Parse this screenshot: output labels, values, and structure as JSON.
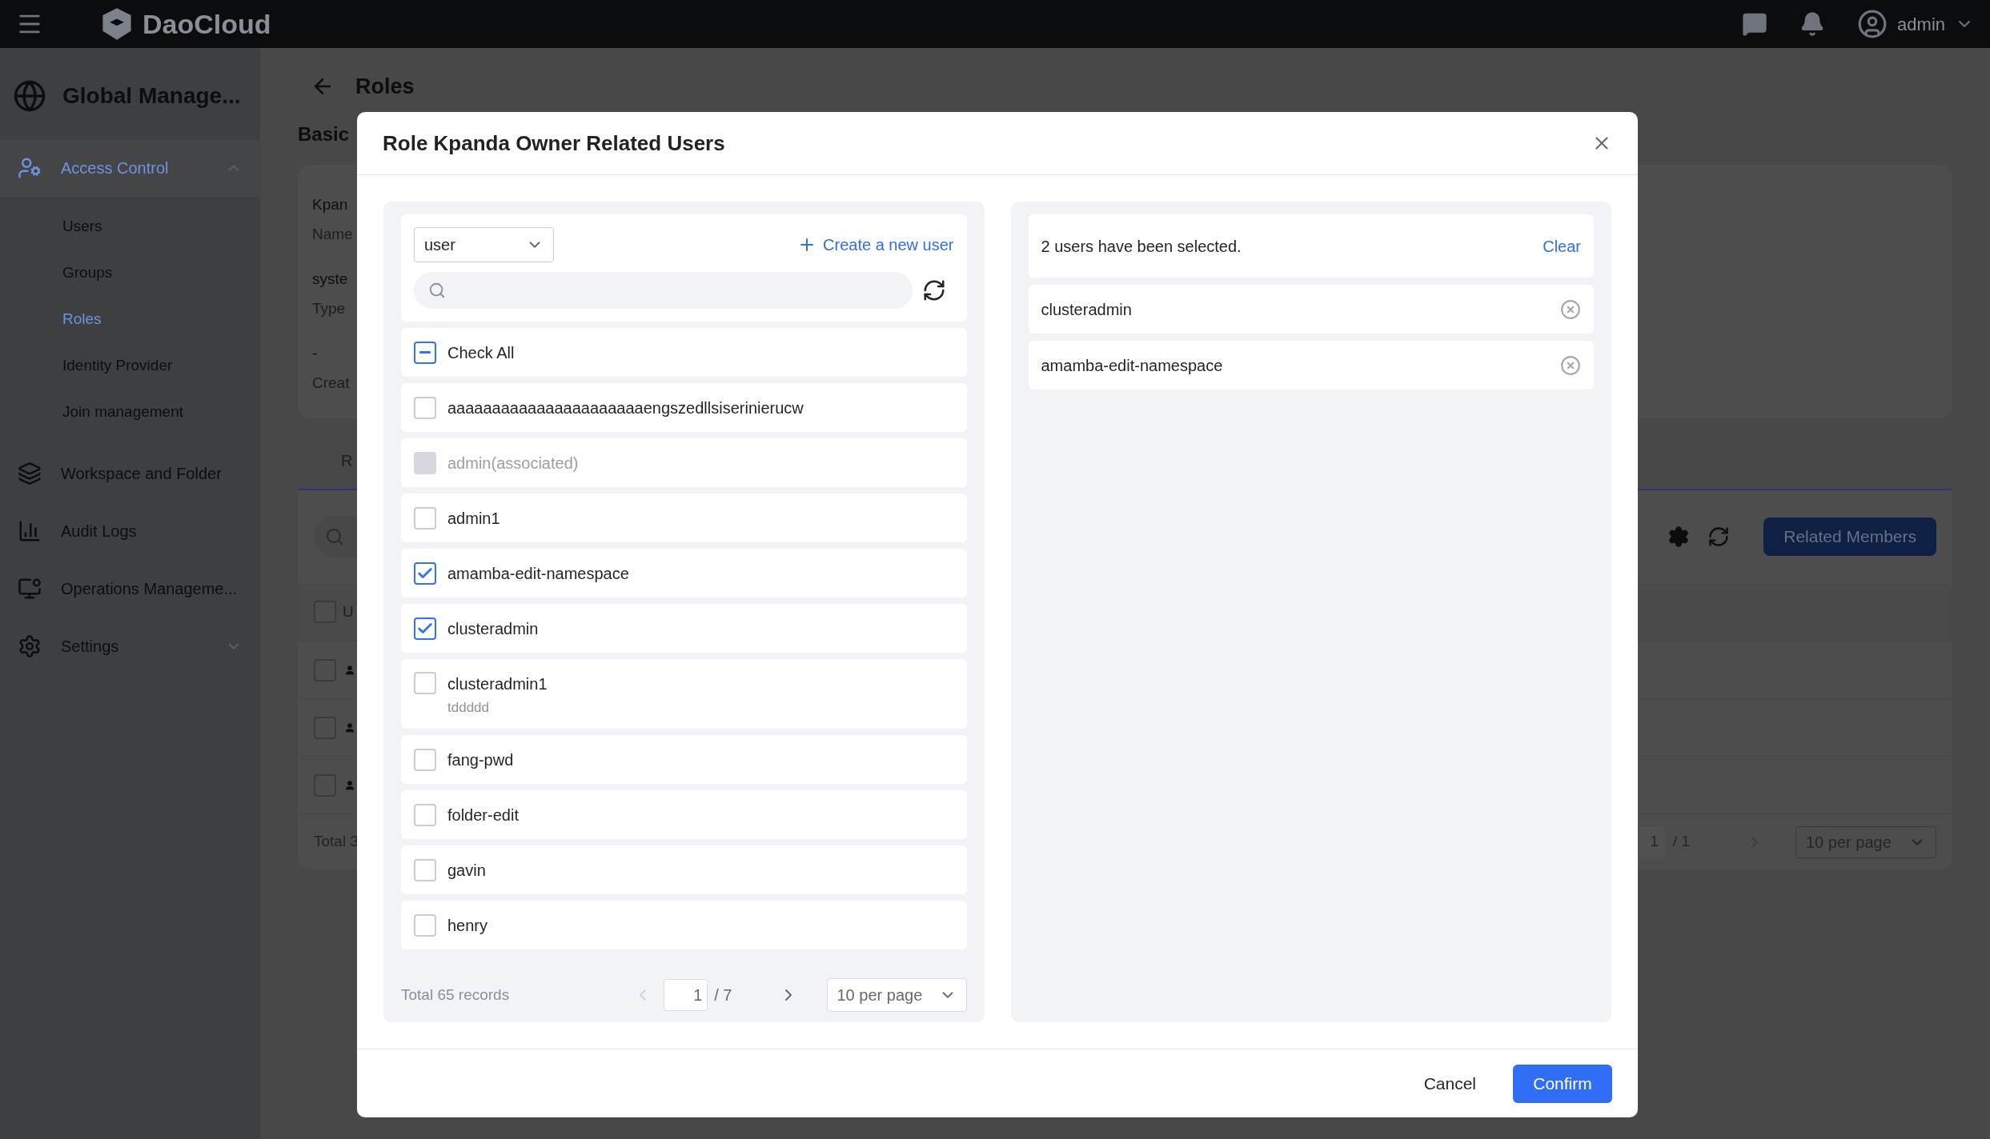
{
  "top_bar": {
    "brand": "DaoCloud",
    "user": "admin"
  },
  "sidebar": {
    "title": "Global Manage...",
    "items": [
      {
        "label": "Access Control",
        "kind": "group",
        "selected": true,
        "expanded": true,
        "children": [
          {
            "label": "Users",
            "selected": false
          },
          {
            "label": "Groups",
            "selected": false
          },
          {
            "label": "Roles",
            "selected": true
          },
          {
            "label": "Identity Provider",
            "selected": false
          },
          {
            "label": "Join management",
            "selected": false
          }
        ]
      },
      {
        "label": "Workspace and Folder",
        "kind": "link",
        "selected": false
      },
      {
        "label": "Audit Logs",
        "kind": "link",
        "selected": false
      },
      {
        "label": "Operations Manageme...",
        "kind": "link",
        "selected": false
      },
      {
        "label": "Settings",
        "kind": "group",
        "selected": false,
        "expanded": false
      }
    ]
  },
  "page": {
    "title": "Roles",
    "section": "Basic",
    "info": [
      {
        "value": "Kpan",
        "label": "Name"
      },
      {
        "value": "syste",
        "label": "Type"
      },
      {
        "value": "-",
        "label": "Creat"
      }
    ],
    "tab": "R",
    "table": {
      "header": "U",
      "all_checked": false,
      "rows": [
        {
          "checked": false
        },
        {
          "checked": false
        },
        {
          "checked": false
        }
      ],
      "total": "Total 3"
    },
    "related_button": "Related Members",
    "pagination": {
      "page": "1",
      "pages": "/ 1",
      "page_size": "10 per page"
    }
  },
  "dialog": {
    "title": "Role Kpanda Owner Related Users",
    "left": {
      "filter": "user",
      "create_link": "Create a new user",
      "check_all": {
        "label": "Check All",
        "indeterminate": true
      },
      "users": [
        {
          "name": "aaaaaaaaaaaaaaaaaaaaaaengszedllsiserinierucw",
          "checked": false,
          "disabled": false
        },
        {
          "name": "admin(associated)",
          "checked": false,
          "disabled": true
        },
        {
          "name": "admin1",
          "checked": false,
          "disabled": false
        },
        {
          "name": "amamba-edit-namespace",
          "checked": true,
          "disabled": false
        },
        {
          "name": "clusteradmin",
          "checked": true,
          "disabled": false
        },
        {
          "name": "clusteradmin1",
          "note": "tddddd",
          "checked": false,
          "disabled": false
        },
        {
          "name": "fang-pwd",
          "checked": false,
          "disabled": false
        },
        {
          "name": "folder-edit",
          "checked": false,
          "disabled": false
        },
        {
          "name": "gavin",
          "checked": false,
          "disabled": false
        },
        {
          "name": "henry",
          "checked": false,
          "disabled": false
        }
      ],
      "pagination": {
        "total": "Total 65 records",
        "prev_disabled": true,
        "page": "1",
        "pages": "/ 7",
        "next_disabled": false,
        "page_size": "10 per page"
      }
    },
    "right": {
      "summary": "2 users have been selected.",
      "clear": "Clear",
      "selected": [
        "clusteradmin",
        "amamba-edit-namespace"
      ]
    },
    "buttons": {
      "cancel": "Cancel",
      "confirm": "Confirm"
    }
  }
}
